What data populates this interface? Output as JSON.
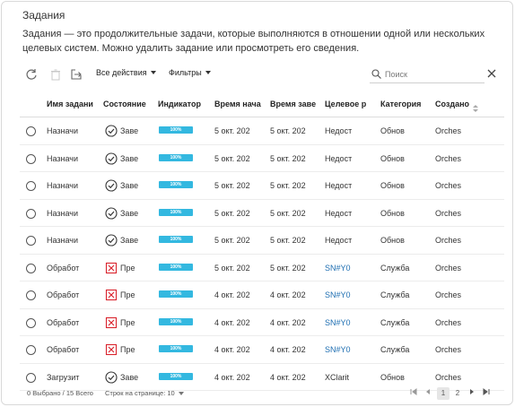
{
  "panel": {
    "title": "Задания",
    "description": "Задания — это продолжительные задачи, которые выполняются в отношении одной или нескольких целевых систем. Можно удалить задание или просмотреть его сведения."
  },
  "toolbar": {
    "all_actions": "Все действия",
    "filters": "Фильтры",
    "search_placeholder": "Поиск"
  },
  "columns": [
    "Имя задани",
    "Состояние",
    "Индикатор",
    "Время нача",
    "Время заве",
    "Целевое р",
    "Категория",
    "Создано"
  ],
  "rows": [
    {
      "name": "Назначи",
      "status": "Заве",
      "status_type": "done",
      "progress": "100%",
      "start": "5 окт. 202",
      "end": "5 окт. 202",
      "target": "Недост",
      "target_link": false,
      "category": "Обнов",
      "created": "Orches"
    },
    {
      "name": "Назначи",
      "status": "Заве",
      "status_type": "done",
      "progress": "100%",
      "start": "5 окт. 202",
      "end": "5 окт. 202",
      "target": "Недост",
      "target_link": false,
      "category": "Обнов",
      "created": "Orches"
    },
    {
      "name": "Назначи",
      "status": "Заве",
      "status_type": "done",
      "progress": "100%",
      "start": "5 окт. 202",
      "end": "5 окт. 202",
      "target": "Недост",
      "target_link": false,
      "category": "Обнов",
      "created": "Orches"
    },
    {
      "name": "Назначи",
      "status": "Заве",
      "status_type": "done",
      "progress": "100%",
      "start": "5 окт. 202",
      "end": "5 окт. 202",
      "target": "Недост",
      "target_link": false,
      "category": "Обнов",
      "created": "Orches"
    },
    {
      "name": "Назначи",
      "status": "Заве",
      "status_type": "done",
      "progress": "100%",
      "start": "5 окт. 202",
      "end": "5 окт. 202",
      "target": "Недост",
      "target_link": false,
      "category": "Обнов",
      "created": "Orches"
    },
    {
      "name": "Обработ",
      "status": "Пре",
      "status_type": "error",
      "progress": "100%",
      "start": "5 окт. 202",
      "end": "5 окт. 202",
      "target": "SN#Y0",
      "target_link": true,
      "category": "Служба",
      "created": "Orches"
    },
    {
      "name": "Обработ",
      "status": "Пре",
      "status_type": "error",
      "progress": "100%",
      "start": "4 окт. 202",
      "end": "4 окт. 202",
      "target": "SN#Y0",
      "target_link": true,
      "category": "Служба",
      "created": "Orches"
    },
    {
      "name": "Обработ",
      "status": "Пре",
      "status_type": "error",
      "progress": "100%",
      "start": "4 окт. 202",
      "end": "4 окт. 202",
      "target": "SN#Y0",
      "target_link": true,
      "category": "Служба",
      "created": "Orches"
    },
    {
      "name": "Обработ",
      "status": "Пре",
      "status_type": "error",
      "progress": "100%",
      "start": "4 окт. 202",
      "end": "4 окт. 202",
      "target": "SN#Y0",
      "target_link": true,
      "category": "Служба",
      "created": "Orches"
    },
    {
      "name": "Загрузит",
      "status": "Заве",
      "status_type": "done",
      "progress": "100%",
      "start": "4 окт. 202",
      "end": "4 окт. 202",
      "target": "XClarit",
      "target_link": false,
      "category": "Обнов",
      "created": "Orches"
    }
  ],
  "footer": {
    "selected": "0 Выбрано / 15 Всего",
    "rows_per_page": "Строк на странице: 10",
    "pages": [
      "1",
      "2"
    ],
    "current_page": "1"
  },
  "colors": {
    "progress": "#33b8e0",
    "error": "#d9232d",
    "link": "#1f6fb2"
  },
  "icons": [
    "refresh-icon",
    "delete-icon",
    "export-icon",
    "search-icon",
    "close-icon",
    "check-circle-icon",
    "error-box-icon",
    "sort-icon",
    "first-page-icon",
    "prev-page-icon",
    "next-page-icon",
    "last-page-icon"
  ]
}
